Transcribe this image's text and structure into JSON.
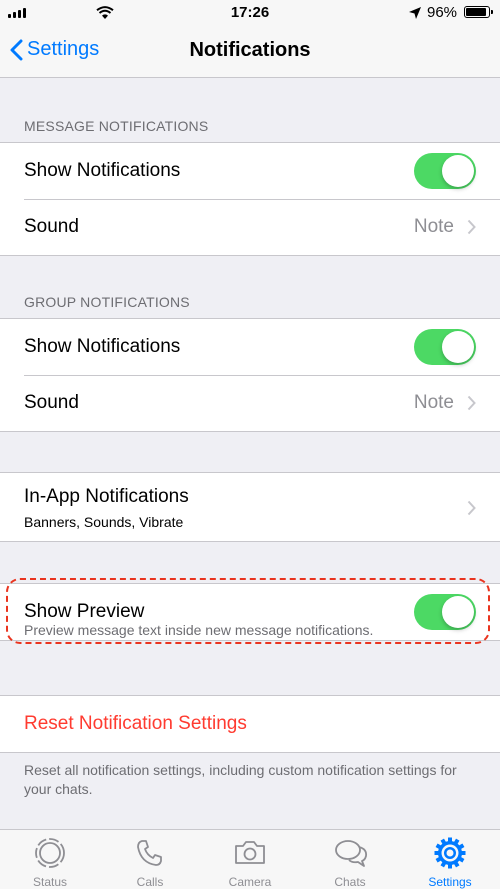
{
  "status": {
    "time": "17:26",
    "battery": "96%",
    "battery_level": 0.96
  },
  "nav": {
    "back_label": "Settings",
    "title": "Notifications"
  },
  "message_notifications": {
    "header": "MESSAGE NOTIFICATIONS",
    "show_label": "Show Notifications",
    "show_on": true,
    "sound_label": "Sound",
    "sound_value": "Note"
  },
  "group_notifications": {
    "header": "GROUP NOTIFICATIONS",
    "show_label": "Show Notifications",
    "show_on": true,
    "sound_label": "Sound",
    "sound_value": "Note"
  },
  "in_app": {
    "label": "In-App Notifications",
    "sub": "Banners, Sounds, Vibrate"
  },
  "preview": {
    "label": "Show Preview",
    "on": true,
    "footer": "Preview message text inside new message notifications."
  },
  "reset": {
    "label": "Reset Notification Settings",
    "footer": "Reset all notification settings, including custom notification settings for your chats."
  },
  "tabs": [
    {
      "label": "Status",
      "icon": "status-icon"
    },
    {
      "label": "Calls",
      "icon": "phone-icon"
    },
    {
      "label": "Camera",
      "icon": "camera-icon"
    },
    {
      "label": "Chats",
      "icon": "chats-icon"
    },
    {
      "label": "Settings",
      "icon": "gear-icon",
      "active": true
    }
  ],
  "colors": {
    "accent": "#007aff",
    "toggle_on": "#4cd964",
    "destructive": "#ff3b30",
    "annotation": "#e9341f"
  }
}
